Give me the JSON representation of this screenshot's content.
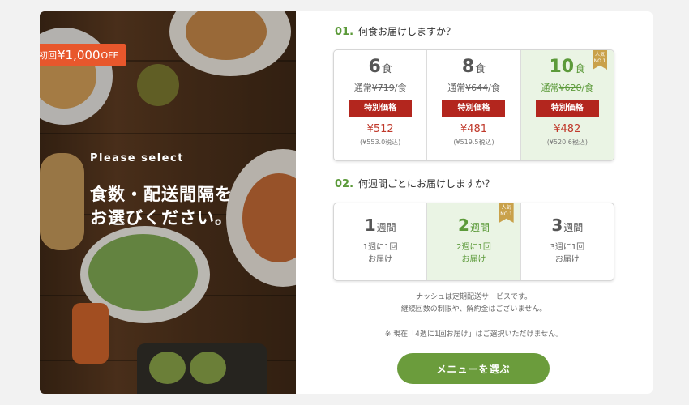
{
  "hero": {
    "discount_prefix": "初回",
    "discount_amount": "¥1,000",
    "discount_suffix": "OFF",
    "please_select": "Please select",
    "headline_line1": "食数・配送間隔を",
    "headline_line2": "お選びください。"
  },
  "meals": {
    "number": "01.",
    "question": "何食お届けしますか？",
    "options": [
      {
        "count": "6",
        "unit": "食",
        "regular_prefix": "通常",
        "regular_price": "¥719",
        "regular_suffix": "/食",
        "special_label": "特別価格",
        "price": "¥512",
        "tax_included": "(¥553.0税込)",
        "selected": false
      },
      {
        "count": "8",
        "unit": "食",
        "regular_prefix": "通常",
        "regular_price": "¥644",
        "regular_suffix": "/食",
        "special_label": "特別価格",
        "price": "¥481",
        "tax_included": "(¥519.5税込)",
        "selected": false
      },
      {
        "count": "10",
        "unit": "食",
        "regular_prefix": "通常",
        "regular_price": "¥620",
        "regular_suffix": "/食",
        "special_label": "特別価格",
        "price": "¥482",
        "tax_included": "(¥520.6税込)",
        "selected": true,
        "ribbon": "人気 NO.1"
      }
    ]
  },
  "weeks": {
    "number": "02.",
    "question": "何週間ごとにお届けしますか？",
    "options": [
      {
        "count": "1",
        "unit": "週間",
        "desc": "1週に1回\nお届け",
        "selected": false
      },
      {
        "count": "2",
        "unit": "週間",
        "desc": "2週に1回\nお届け",
        "selected": true,
        "ribbon": "人気 NO.1"
      },
      {
        "count": "3",
        "unit": "週間",
        "desc": "3週に1回\nお届け",
        "selected": false
      }
    ]
  },
  "notes": {
    "line1": "ナッシュは定期配送サービスです。",
    "line2": "継続回数の制限や、解約金はございません。",
    "line3": "※ 現在「4週に1回お届け」はご選択いただけません。"
  },
  "cta": {
    "label": "メニューを選ぶ"
  },
  "colors": {
    "accent_green": "#6b9c3c",
    "selected_bg": "#eaf4e4",
    "special_red": "#b3261e",
    "discount_orange": "#e8572c",
    "ribbon_gold": "#c9a14a"
  }
}
